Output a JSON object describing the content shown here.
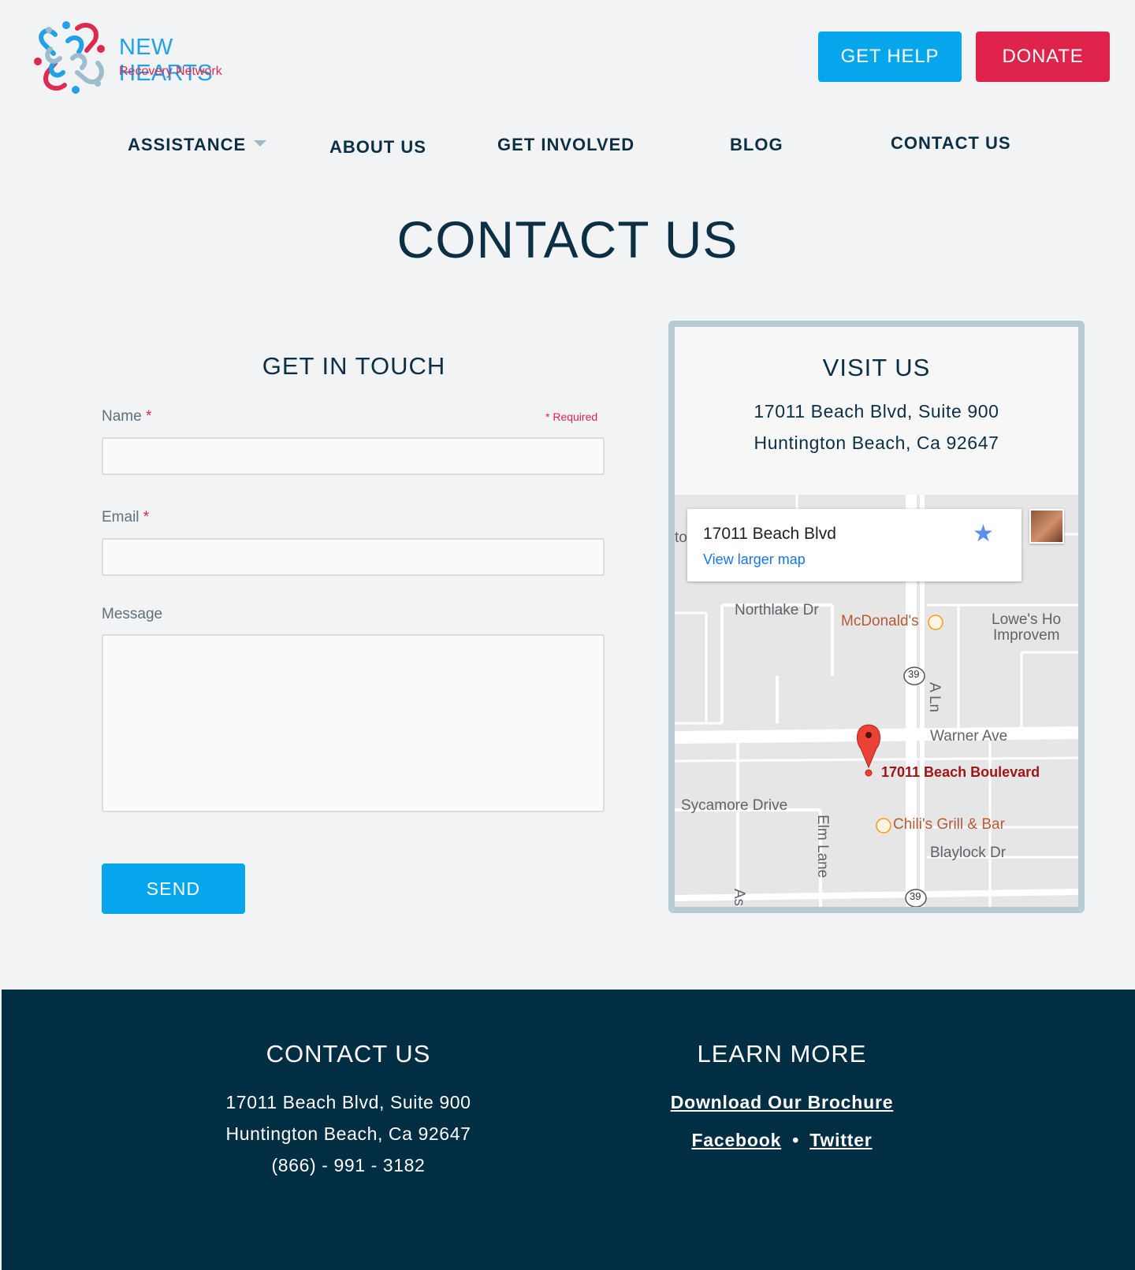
{
  "header": {
    "logo_title": "NEW HEARTS",
    "logo_subtitle": "Recovery Network",
    "get_help_label": "GET HELP",
    "donate_label": "DONATE"
  },
  "nav": {
    "items": [
      {
        "label": "ASSISTANCE",
        "has_dropdown": true
      },
      {
        "label": "ABOUT US"
      },
      {
        "label": "GET INVOLVED"
      },
      {
        "label": "BLOG"
      },
      {
        "label": "CONTACT US"
      }
    ]
  },
  "page": {
    "title": "CONTACT US"
  },
  "form": {
    "title": "GET IN TOUCH",
    "name_label": "Name",
    "email_label": "Email",
    "message_label": "Message",
    "required_marker": "*",
    "required_note": "* Required",
    "name_value": "",
    "email_value": "",
    "message_value": "",
    "send_label": "SEND"
  },
  "visit": {
    "title": "VISIT US",
    "address_line1": "17011 Beach Blvd, Suite 900",
    "address_line2": "Huntington Beach, Ca 92647",
    "map": {
      "info_title": "17011 Beach Blvd",
      "info_link": "View larger map",
      "labels": {
        "northlake": "Northlake Dr",
        "mcdonalds": "McDonald's",
        "lowes1": "Lowe's Ho",
        "lowes2": "Improvem",
        "a_ln": "A Ln",
        "warner": "Warner Ave",
        "destination": "17011 Beach Boulevard",
        "sycamore": "Sycamore Drive",
        "elm": "Elm Lane",
        "chilis": "Chili's Grill & Bar",
        "blaylock": "Blaylock Dr",
        "route": "39",
        "edge_left": "to",
        "edge_bottom": "Asi"
      }
    }
  },
  "footer": {
    "contact_title": "CONTACT US",
    "address_line1": "17011 Beach Blvd, Suite 900",
    "address_line2": "Huntington Beach, Ca 92647",
    "phone": "(866) - 991 - 3182",
    "learn_title": "LEARN MORE",
    "brochure_link": "Download Our Brochure",
    "facebook_link": "Facebook",
    "separator": "•",
    "twitter_link": "Twitter"
  },
  "colors": {
    "brand_blue": "#06a6ec",
    "brand_red": "#e0234b",
    "navy": "#0d2f43",
    "footer_bg": "#022e44",
    "page_bg": "#f2f3f5"
  }
}
